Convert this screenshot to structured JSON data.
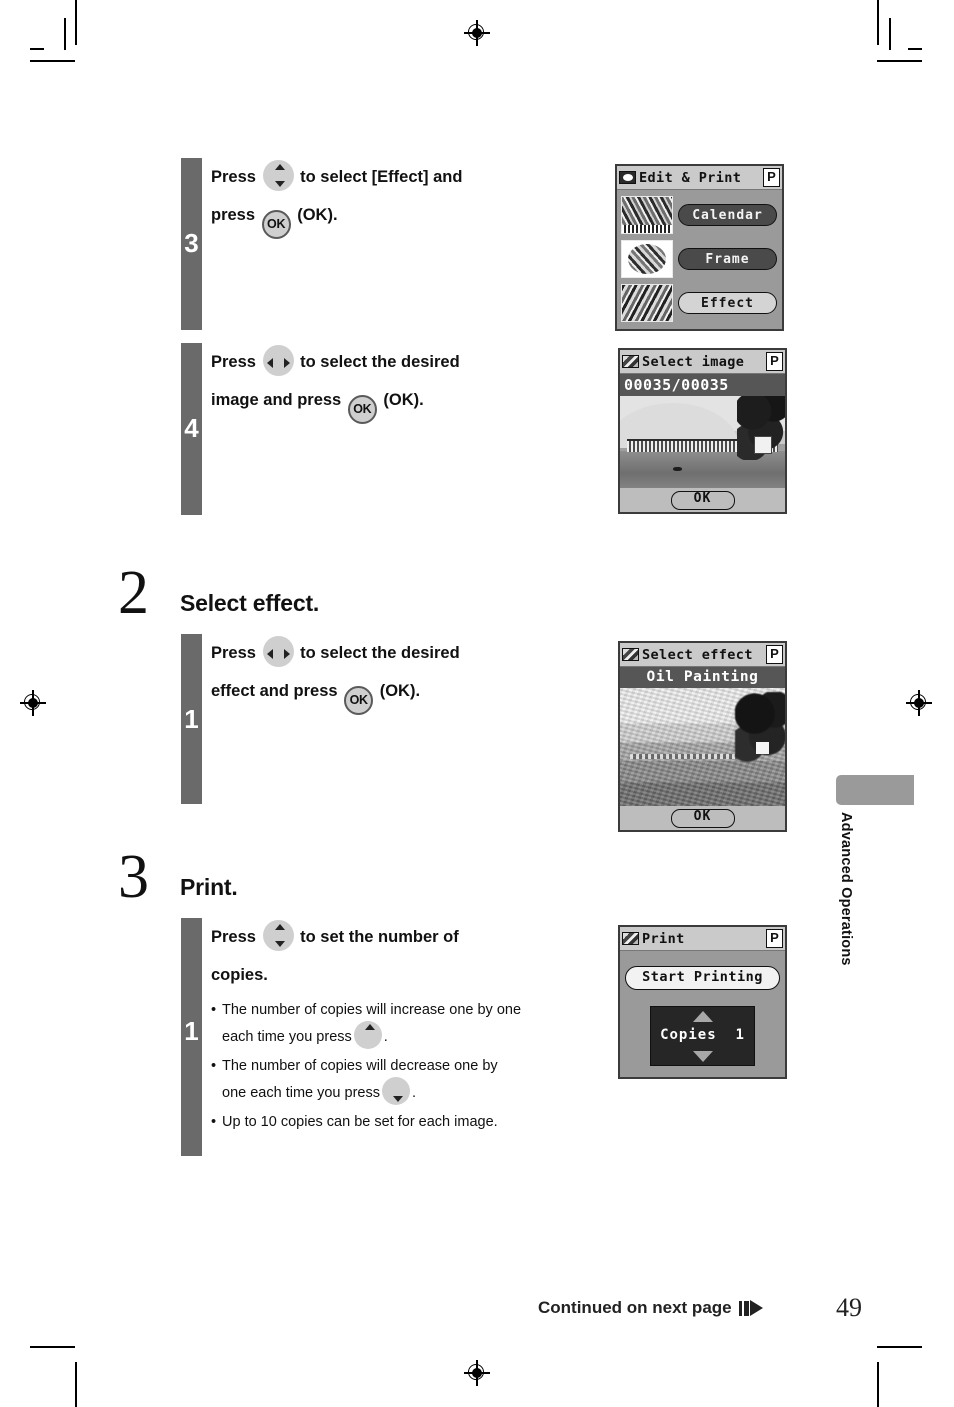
{
  "page": {
    "number": "49",
    "continued_label": "Continued on next page",
    "side_tab_label": "Advanced Operations"
  },
  "steps_top": [
    {
      "number": "3",
      "lines": [
        {
          "pre": "Press ",
          "icon": "updown-button-icon",
          "mid": " to select [Effect] and"
        },
        {
          "pre": "press ",
          "icon": "ok-button-icon",
          "icon_label": "OK",
          "mid": " (OK)."
        }
      ]
    },
    {
      "number": "4",
      "lines": [
        {
          "pre": "Press ",
          "icon": "leftright-button-icon",
          "mid": " to select the desired"
        },
        {
          "pre": "image and press ",
          "icon": "ok-button-icon",
          "icon_label": "OK",
          "mid": " (OK)."
        }
      ]
    }
  ],
  "sections": [
    {
      "number": "2",
      "title": "Select effect.",
      "substep": {
        "number": "1",
        "lines": [
          {
            "pre": "Press ",
            "icon": "leftright-button-icon",
            "mid": " to select the desired"
          },
          {
            "pre": "effect and press ",
            "icon": "ok-button-icon",
            "icon_label": "OK",
            "mid": " (OK)."
          }
        ]
      }
    },
    {
      "number": "3",
      "title": "Print.",
      "substep": {
        "number": "1",
        "lines": [
          {
            "pre": "Press ",
            "icon": "updown-button-icon",
            "mid": " to set the number of"
          },
          {
            "pre": "copies.",
            "icon": "",
            "mid": ""
          }
        ],
        "notes": [
          {
            "bullet": "•",
            "part1": "The number of copies will increase one by one",
            "part2": "each time you press",
            "icon": "up-button-icon",
            "part3": "."
          },
          {
            "bullet": "•",
            "part1": "The number of copies will decrease one by",
            "part2": "one each time you press",
            "icon": "down-button-icon",
            "part3": "."
          },
          {
            "bullet": "•",
            "part1": "Up to 10 copies can be set for each image.",
            "part2": "",
            "icon": "",
            "part3": ""
          }
        ]
      }
    }
  ],
  "lcd_screens": {
    "edit_print": {
      "title": "Edit & Print",
      "title_icon": "screen-icon",
      "badge": "P",
      "rows": [
        {
          "label": "Calendar",
          "selected": false,
          "thumb": "calendar-thumbnail"
        },
        {
          "label": "Frame",
          "selected": false,
          "thumb": "frame-thumbnail"
        },
        {
          "label": "Effect",
          "selected": true,
          "thumb": "effect-thumbnail"
        }
      ]
    },
    "select_image": {
      "title": "Select image",
      "title_icon": "photo-icon",
      "badge": "P",
      "counter": "00035/00035",
      "ok_label": "OK"
    },
    "select_effect": {
      "title": "Select effect",
      "title_icon": "photo-icon",
      "badge": "P",
      "effect_name": "Oil Painting",
      "ok_label": "OK"
    },
    "print": {
      "title": "Print",
      "title_icon": "photo-icon",
      "badge": "P",
      "start_label": "Start Printing",
      "copies_label": "Copies  1"
    }
  },
  "colors": {
    "step_bar_gray": "#6a6a6a",
    "lcd_background": "#9a9a9a",
    "lcd_title_bar": "#cacaca",
    "side_tab_gray": "#9a9a9a"
  }
}
